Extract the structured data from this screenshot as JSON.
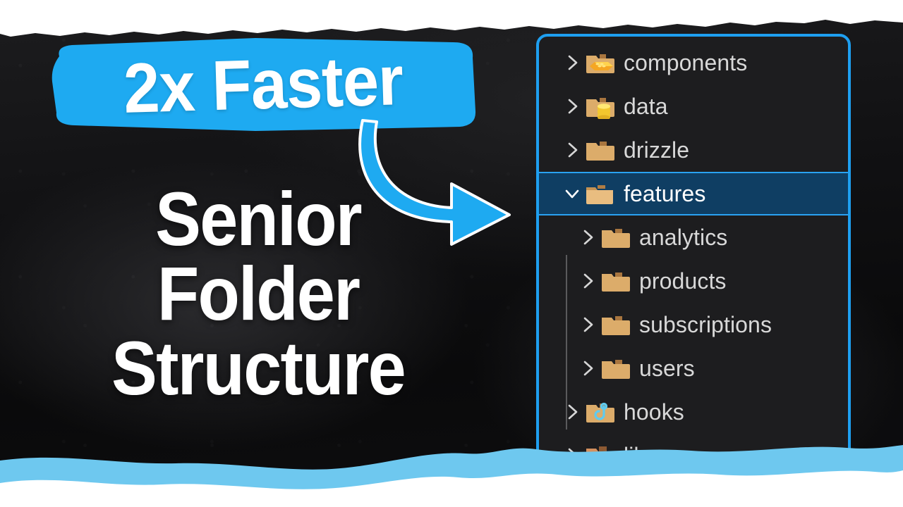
{
  "thumbnail": {
    "badge": {
      "label": "2x Faster",
      "bg_color": "#1eaaf1",
      "text_color": "#ffffff"
    },
    "headline_lines": [
      "Senior",
      "Folder",
      "Structure"
    ],
    "headline_color": "#ffffff",
    "arrow": {
      "name": "curved-arrow",
      "color": "#1eaaf1",
      "outline_color": "#ffffff"
    },
    "background_color": "#0b0b0c",
    "accent_color": "#1e9ff0",
    "edge_top_color": "#ffffff",
    "edge_bottom_colors": [
      "#6ec8ef",
      "#ffffff"
    ]
  },
  "file_tree": {
    "panel_border_color": "#1e9ff0",
    "panel_background": "#1d1d1f",
    "selected_row_background": "#0f3e63",
    "selected_row_border": "#2aa2f2",
    "rows": [
      {
        "name": "components",
        "icon": "folder-lego-icon",
        "chevron": "chevron-right",
        "expanded": false,
        "depth": 0,
        "selected": false
      },
      {
        "name": "data",
        "icon": "folder-database-icon",
        "chevron": "chevron-right",
        "expanded": false,
        "depth": 0,
        "selected": false
      },
      {
        "name": "drizzle",
        "icon": "folder-icon",
        "chevron": "chevron-right",
        "expanded": false,
        "depth": 0,
        "selected": false
      },
      {
        "name": "features",
        "icon": "folder-open-icon",
        "chevron": "chevron-down",
        "expanded": true,
        "depth": 0,
        "selected": true
      },
      {
        "name": "analytics",
        "icon": "folder-icon",
        "chevron": "chevron-right",
        "expanded": false,
        "depth": 1,
        "selected": false
      },
      {
        "name": "products",
        "icon": "folder-icon",
        "chevron": "chevron-right",
        "expanded": false,
        "depth": 1,
        "selected": false
      },
      {
        "name": "subscriptions",
        "icon": "folder-icon",
        "chevron": "chevron-right",
        "expanded": false,
        "depth": 1,
        "selected": false
      },
      {
        "name": "users",
        "icon": "folder-icon",
        "chevron": "chevron-right",
        "expanded": false,
        "depth": 1,
        "selected": false
      },
      {
        "name": "hooks",
        "icon": "folder-hook-icon",
        "chevron": "chevron-right",
        "expanded": false,
        "depth": 0,
        "selected": false
      },
      {
        "name": "lib",
        "icon": "folder-books-icon",
        "chevron": "chevron-right",
        "expanded": false,
        "depth": 0,
        "selected": false
      }
    ]
  }
}
